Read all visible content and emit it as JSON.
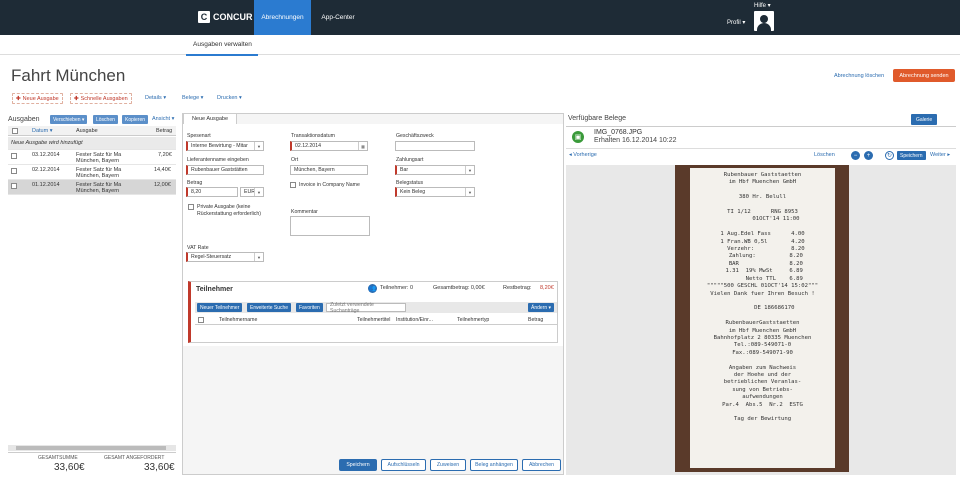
{
  "brand": {
    "name": "CONCUR",
    "logo_letter": "C"
  },
  "topnav": {
    "active": "Abrechnungen",
    "item2": "App-Center",
    "hilfe": "Hilfe ▾",
    "profil": "Profil ▾"
  },
  "subnav": {
    "active": "Ausgaben verwalten"
  },
  "page": {
    "title": "Fahrt München",
    "delete_link": "Abrechnung löschen",
    "submit_button": "Abrechnung senden"
  },
  "toolbar": {
    "new_expense": "Neue Ausgabe",
    "quick_expenses": "Schnelle Ausgaben",
    "details": "Details ▾",
    "receipts": "Belege ▾",
    "print": "Drucken ▾"
  },
  "expenses": {
    "label": "Ausgaben",
    "move": "Verschieben ▾",
    "delete": "Löschen",
    "copy": "Kopieren",
    "view": "Ansicht ▾",
    "columns": [
      "Datum ▾",
      "Ausgabe",
      "Betrag"
    ],
    "adding_row": "Neue Ausgabe wird hinzufügt",
    "rows": [
      {
        "date": "03.12.2014",
        "name": "Fester Satz für Ma",
        "place": "München, Bayern",
        "amount": "7,20€"
      },
      {
        "date": "02.12.2014",
        "name": "Fester Satz für Ma",
        "place": "München, Bayern",
        "amount": "14,40€"
      },
      {
        "date": "01.12.2014",
        "name": "Fester Satz für Ma",
        "place": "München, Bayern",
        "amount": "12,00€"
      }
    ],
    "total_label": "GESAMTSUMME",
    "total_value": "33,60€",
    "requested_label": "GESAMT ANGEFORDERT",
    "requested_value": "33,60€"
  },
  "form": {
    "tab": "Neue Ausgabe",
    "spesenart_label": "Spesenart",
    "spesenart_value": "Interne Bewirtung - Mitar",
    "lieferant_label": "Lieferantenname eingeben",
    "lieferant_value": "Rubenbauer Gaststätten",
    "betrag_label": "Betrag",
    "betrag_value": "8,20",
    "currency": "EUR",
    "private_label": "Private Ausgabe (keine Rückerstattung erforderlich)",
    "vat_label": "VAT Rate",
    "vat_value": "Regel-Steuersatz",
    "datum_label": "Transaktionsdatum",
    "datum_value": "02.12.2014",
    "ort_label": "Ort",
    "ort_value": "München, Bayern",
    "invoice_label": "Invoice in Company Name",
    "kommentar_label": "Kommentar",
    "zweck_label": "Geschäftszweck",
    "zahlungsart_label": "Zahlungsart",
    "zahlungsart_value": "Bar",
    "belegstatus_label": "Belegstatus",
    "belegstatus_value": "Kein Beleg"
  },
  "participants": {
    "title": "Teilnehmer",
    "count": "Teilnehmer: 0",
    "total": "Gesamtbetrag: 0,00€",
    "rest_label": "Restbetrag:",
    "rest_value": "8,20€",
    "new_btn": "Neuer Teilnehmer",
    "search_btn": "Erweiterte Suche",
    "fav_btn": "Favoriten",
    "search_placeholder": "Zuletzt verwendete Suchanträge",
    "change_btn": "Ändern ▾",
    "columns": [
      "Teilnehmername",
      "Teilnehmertitel",
      "Institution/Einr...",
      "Teilnehmertyp",
      "Betrag"
    ]
  },
  "actions": {
    "save": "Speichern",
    "itemize": "Aufschlüsseln",
    "assign": "Zuweisen",
    "attach": "Beleg anhängen",
    "cancel": "Abbrechen"
  },
  "receipts": {
    "label": "Verfügbare Belege",
    "gallery": "Galerie",
    "filename": "IMG_0768.JPG",
    "received": "Erhalten 16.12.2014 10:22",
    "prev": "◂ Vorherige",
    "delete": "Löschen",
    "save": "Speichern",
    "next": "Weiter ▸",
    "receipt_text": "Rubenbauer Gaststaetten\nim Hbf Muenchen GmbH\n\n380 Hr. Belull\n\nTI 1/12      RNG 8953\n        01OCT'14 11:00\n\n1 Aug.Edel Fass      4.00\n1 Fran.WB 0,5l       4.20\n  Verzehr:           8.20\n  Zahlung:          8.20\n  BAR               8.20\n 1.31  19% MwSt     6.89\n       Netto TTL    6.89\n\"\"\"\"\"500 GESCHL 01OCT'14 15:02\"\"\"\nVielen Dank fuer Ihren Besuch !\n\n       DE 186686170\n\nRubenbauerGaststaetten\nim Hbf Muenchen GmbH\nBahnhofplatz 2 80335 Muenchen\nTel.:089-549071-0\nFax.:089-549071-90\n\nAngaben zum Nachweis\nder Hoehe und der\nbetrieblichen Veranlas-\nsung von Betriebs-\naufwendungen\nPar.4  Abs.5  Nr.2  ESTG\n\nTag der Bewirtung"
  }
}
